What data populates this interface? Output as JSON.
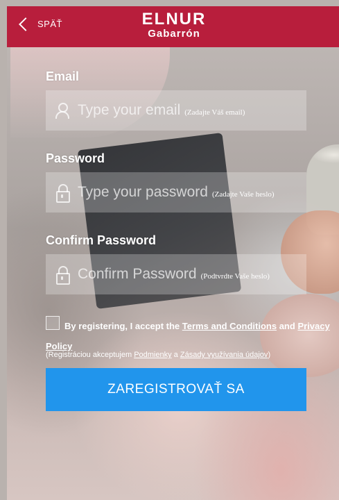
{
  "header": {
    "back_label": "SPÄŤ",
    "logo_line1": "ELNUR",
    "logo_line2": "Gabarrón",
    "color": "#b81e3c"
  },
  "form": {
    "email": {
      "label": "Email",
      "placeholder": "Type your email",
      "placeholder_sk": "(Zadajte Váš email)",
      "icon": "user-icon"
    },
    "password": {
      "label": "Password",
      "placeholder": "Type your password",
      "placeholder_sk": "(Zadajte Vaše heslo)",
      "icon": "lock-icon"
    },
    "confirm_password": {
      "label": "Confirm Password",
      "placeholder": "Confirm Password",
      "placeholder_sk": "(Podtvrdte Vaše heslo)",
      "icon": "lock-icon"
    }
  },
  "terms": {
    "checked": false,
    "prefix": "By registering, I accept the",
    "terms_link": "Terms and Conditions",
    "and": "and",
    "privacy_link": "Privacy Policy",
    "sk_prefix": "(Registráciou akceptujem",
    "sk_terms_link": "Podmienky",
    "sk_and": "a",
    "sk_privacy_link": "Zásady využívania údajov",
    "sk_suffix": ")"
  },
  "register_button": {
    "label": "ZAREGISTROVAŤ SA",
    "color": "#2195ec"
  }
}
